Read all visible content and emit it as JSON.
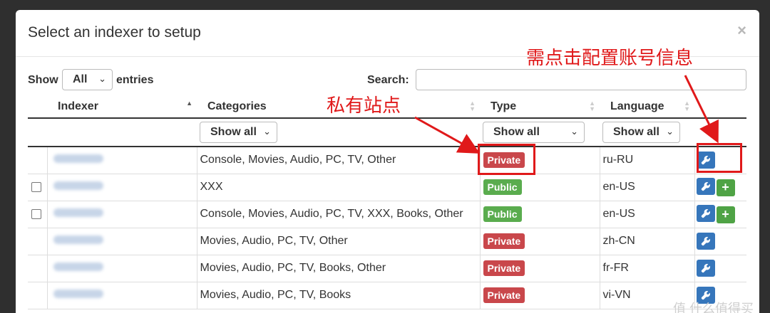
{
  "modal": {
    "title": "Select an indexer to setup",
    "close_symbol": "×"
  },
  "controls": {
    "show_label": "Show",
    "length_value": "All",
    "entries_label": "entries",
    "search_label": "Search:",
    "search_value": ""
  },
  "table": {
    "headers": [
      "Indexer",
      "Categories",
      "Type",
      "Language"
    ],
    "filters": {
      "categories": "Show all",
      "type": "Show all",
      "language": "Show all"
    },
    "rows": [
      {
        "categories": "Console, Movies, Audio, PC, TV, Other",
        "type": "Private",
        "language": "ru-RU",
        "has_checkbox": false,
        "has_add": false
      },
      {
        "categories": "XXX",
        "type": "Public",
        "language": "en-US",
        "has_checkbox": true,
        "has_add": true
      },
      {
        "categories": "Console, Movies, Audio, PC, TV, XXX, Books, Other",
        "type": "Public",
        "language": "en-US",
        "has_checkbox": true,
        "has_add": true
      },
      {
        "categories": "Movies, Audio, PC, TV, Other",
        "type": "Private",
        "language": "zh-CN",
        "has_checkbox": false,
        "has_add": false
      },
      {
        "categories": "Movies, Audio, PC, TV, Books, Other",
        "type": "Private",
        "language": "fr-FR",
        "has_checkbox": false,
        "has_add": false
      },
      {
        "categories": "Movies, Audio, PC, TV, Books",
        "type": "Private",
        "language": "vi-VN",
        "has_checkbox": false,
        "has_add": false
      }
    ]
  },
  "annotations": {
    "private_site": "私有站点",
    "configure_account": "需点击配置账号信息"
  },
  "watermark": "值 什么值得买",
  "colors": {
    "private": "#c9474b",
    "public": "#5aac4e",
    "configure": "#3676bb",
    "add": "#4fa345",
    "annotation": "#e0191a"
  },
  "icons": {
    "configure": "wrench-icon",
    "add": "plus-icon",
    "sort": "sort-arrows-icon"
  }
}
